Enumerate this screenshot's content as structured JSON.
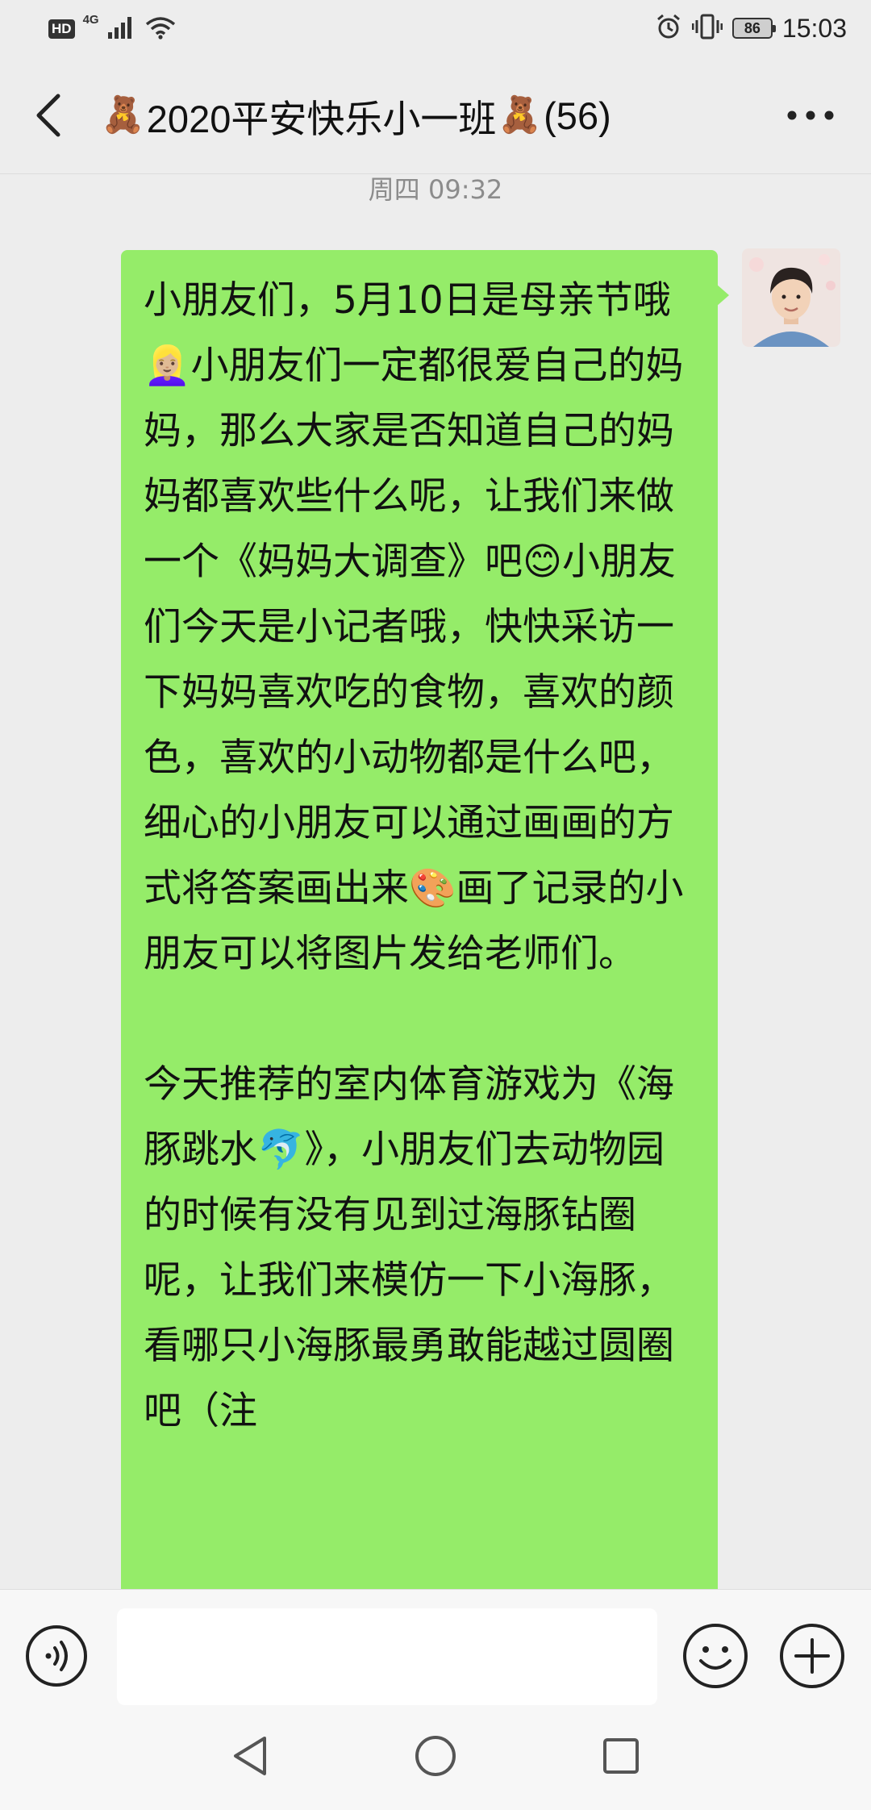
{
  "status_bar": {
    "hd_label": "HD",
    "network_label": "4G",
    "battery_level": "86",
    "time": "15:03"
  },
  "header": {
    "title": "2020平安快乐小一班",
    "member_count": "(56)",
    "title_emoji": "🧸"
  },
  "timestamp": "周四 09:32",
  "message": {
    "text": "小朋友们，5月10日是母亲节哦👱🏼‍♀️小朋友们一定都很爱自己的妈妈，那么大家是否知道自己的妈妈都喜欢些什么呢，让我们来做一个《妈妈大调查》吧😊小朋友们今天是小记者哦，快快采访一下妈妈喜欢吃的食物，喜欢的颜色，喜欢的小动物都是什么吧，细心的小朋友可以通过画画的方式将答案画出来🎨画了记录的小朋友可以将图片发给老师们。\n\n今天推荐的室内体育游戏为《海豚跳水🐬》，小朋友们去动物园的时候有没有见到过海豚钻圈呢，让我们来模仿一下小海豚，看哪只小海豚最勇敢能越过圆圈吧（注",
    "bubble_color": "#95ec69"
  },
  "input_bar": {
    "placeholder": ""
  },
  "icons": {
    "back": "chevron-left-icon",
    "more": "more-dots-icon",
    "voice": "voice-icon",
    "emoji": "emoji-smile-icon",
    "add": "plus-circle-icon",
    "nav_back": "triangle-back-icon",
    "nav_home": "circle-home-icon",
    "nav_recents": "square-recents-icon"
  },
  "colors": {
    "background": "#ededed",
    "bubble": "#95ec69",
    "timestamp": "#8c8c8c"
  }
}
